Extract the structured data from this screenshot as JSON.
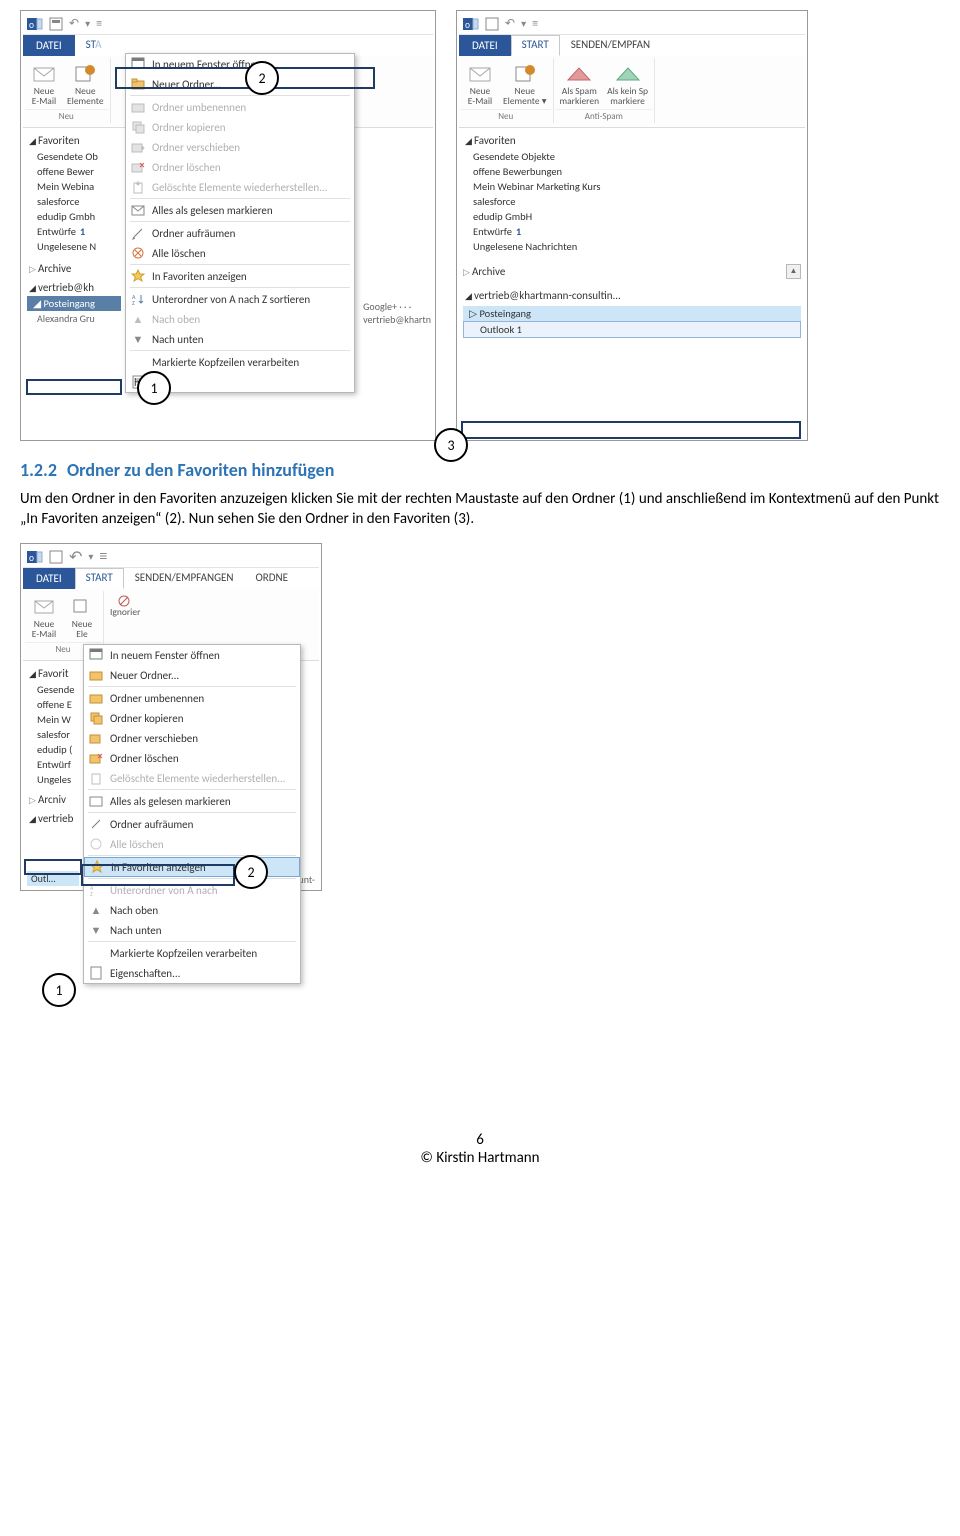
{
  "section": {
    "number": "1.2.2",
    "title": "Ordner zu den Favoriten hinzufügen"
  },
  "body": "Um den Ordner in den Favoriten anzuzeigen klicken Sie mit der rechten Maustaste auf den Ordner (1) und anschließend im Kontextmenü auf den Punkt „In Favoriten anzeigen“ (2). Nun sehen Sie den Ordner in den Favoriten (3).",
  "callouts": {
    "c1": "1",
    "c2": "2",
    "c3": "3"
  },
  "tabs": {
    "datei": "DATEI",
    "start": "START",
    "senden": "SENDEN/EMPFANGEN",
    "senden_short": "SENDEN/EMPFAN",
    "ordner": "ORDNE"
  },
  "ribbon": {
    "neue_email": "Neue\nE-Mail",
    "neue_elemente": "Neue\nElemente",
    "neue_elemente_wide": "Neue\nElemente ▾",
    "neue_ele_short": "Neue\nEle",
    "neu_group": "Neu",
    "als_spam": "Als Spam\nmarkieren",
    "als_kein_sp": "Als kein Sp\nmarkiere",
    "anti_spam": "Anti-Spam",
    "ignorier": "Ignorier"
  },
  "sidebar": {
    "favoriten": "Favoriten",
    "gesendete_ob": "Gesendete Ob",
    "gesendete_full": "Gesendete Objekte",
    "offene_bewer": "offene Bewer",
    "offene_full": "offene Bewerbungen",
    "mein_web": "Mein Webina",
    "mein_web_full": "Mein Webinar Marketing Kurs",
    "mein_w": "Mein W",
    "salesforce": "salesforce",
    "salesfor": "salesfor",
    "edudip": "edudip Gmbh",
    "edudip_full": "edudip GmbH",
    "edudip_short": "edudip (",
    "entwuerfe": "Entwürfe",
    "entwuerfe_count": "1",
    "ungelesene": "Ungelesene N",
    "ungelesene_full": "Ungelesene Nachrichten",
    "ungeles": "Ungeles",
    "archive": "Archive",
    "vertrieb_kh": "vertrieb@kh",
    "vertrieb_full": "vertrieb@khartmann-consultin...",
    "vertrieb_short": "vertrieb",
    "posteingang": "Posteingang",
    "alexandra": "Alexandra Gru",
    "outlook1": "Outlook 1",
    "google": "Google+ · · ·",
    "vertrieb_khartn": "vertrieb@khartn",
    "favorit_short": "Favorit",
    "gesende": "Gesende",
    "offene_e": "offene E",
    "entwuerf": "Entwürf",
    "arcniv": "Arcniv",
    "account": "account-"
  },
  "ctx": {
    "in_neuem": "In neuem Fenster öffnen",
    "neuer_ordner": "Neuer Ordner...",
    "umbenennen": "Ordner umbenennen",
    "kopieren": "Ordner kopieren",
    "verschieben": "Ordner verschieben",
    "loeschen": "Ordner löschen",
    "geloeschte": "Gelöschte Elemente wiederherstellen...",
    "alles_gelesen": "Alles als gelesen markieren",
    "aufraeumen": "Ordner aufräumen",
    "alle_loeschen": "Alle löschen",
    "in_favoriten": "In Favoriten anzeigen",
    "sortieren": "Unterordner von A nach Z sortieren",
    "sortieren_short": "Unterordner von A nach",
    "nach_oben": "Nach oben",
    "nach_unten": "Nach unten",
    "kopfzeilen": "Markierte Kopfzeilen verarbeiten",
    "eigenschaften": "Eigenschaften...",
    "haften": "haften..."
  },
  "footer": {
    "page": "6",
    "copyright": "© Kirstin Hartmann"
  }
}
